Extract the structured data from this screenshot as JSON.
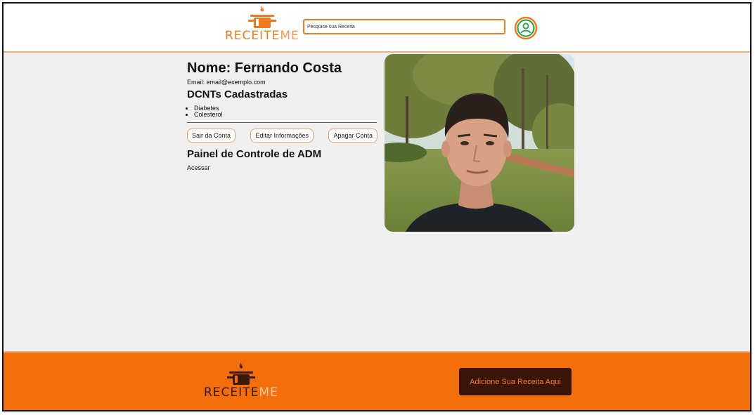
{
  "header": {
    "logo_text_a": "RECEITE",
    "logo_text_b": "ME",
    "search_placeholder": "Pesquise sua Receita",
    "profile_icon": "user-circle-icon"
  },
  "profile": {
    "name": "Nome: Fernando Costa",
    "email": "Email: email@exemplo.com",
    "dcnt_title": "DCNTs Cadastradas",
    "dcnts": [
      "Diabetes",
      "Colesterol"
    ],
    "buttons": {
      "logout": "Sair da Conta",
      "edit": "Editar Informações",
      "delete": "Apagar Conta"
    },
    "admin_title": "Painel de Controle de ADM",
    "admin_link": "Acessar"
  },
  "footer": {
    "logo_text_a": "RECEITE",
    "logo_text_b": "ME",
    "add_recipe": "Adicione Sua Receita Aqui"
  },
  "colors": {
    "brand_orange": "#f46f0c",
    "dark_brown": "#3a1406",
    "page_bg": "#f0f0f0"
  }
}
